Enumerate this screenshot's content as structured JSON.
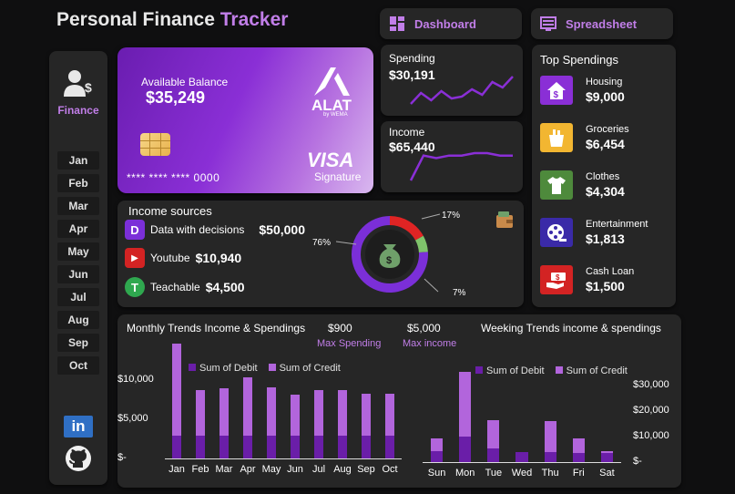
{
  "header": {
    "title_part1": "Personal Finance ",
    "title_part2": "Tracker",
    "dashboard_label": "Dashboard",
    "spreadsheet_label": "Spreadsheet"
  },
  "sidebar": {
    "finance_label": "Finance",
    "months": [
      "Jan",
      "Feb",
      "Mar",
      "Apr",
      "May",
      "Jun",
      "Jul",
      "Aug",
      "Sep",
      "Oct"
    ]
  },
  "card": {
    "balance_label": "Available Balance",
    "balance_value": "$35,249",
    "brand": "ALAT",
    "brand_sub": "by WEMA",
    "number": "**** **** **** 0000",
    "network": "VISA",
    "network_sub": "Signature"
  },
  "spending": {
    "label": "Spending",
    "value": "$30,191",
    "trend": [
      34,
      40,
      36,
      41,
      37,
      38,
      42,
      39,
      46,
      43,
      49
    ]
  },
  "income": {
    "label": "Income",
    "value": "$65,440",
    "trend": [
      48,
      38,
      39,
      38,
      38,
      37,
      37,
      38,
      38
    ]
  },
  "income_sources": {
    "title": "Income sources",
    "items": [
      {
        "name": "Data with decisions",
        "value": "$50,000",
        "icon": "D",
        "color": "#7b2fd8"
      },
      {
        "name": "Youtube",
        "value": "$10,940",
        "icon": "▶",
        "color": "#d32323"
      },
      {
        "name": "Teachable",
        "value": "$4,500",
        "icon": "T",
        "color": "#2fa84f"
      }
    ],
    "donut": {
      "slices": [
        {
          "label": "76%",
          "value": 76,
          "color": "#7b2fd8"
        },
        {
          "label": "17%",
          "value": 17,
          "color": "#e02424"
        },
        {
          "label": "7%",
          "value": 7,
          "color": "#7fc36b"
        }
      ]
    }
  },
  "top_spendings": {
    "title": "Top Spendings",
    "items": [
      {
        "name": "Housing",
        "value": "$9,000",
        "icon": "house-dollar-icon",
        "color": "#8a2fd6"
      },
      {
        "name": "Groceries",
        "value": "$6,454",
        "icon": "grocery-bag-icon",
        "color": "#f2b631"
      },
      {
        "name": "Clothes",
        "value": "$4,304",
        "icon": "shirt-icon",
        "color": "#4e8a3c"
      },
      {
        "name": "Entertainment",
        "value": "$1,813",
        "icon": "film-reel-icon",
        "color": "#3a2aa8"
      },
      {
        "name": "Cash Loan",
        "value": "$1,500",
        "icon": "cash-hand-icon",
        "color": "#d32323"
      }
    ]
  },
  "trends": {
    "monthly_title": "Monthly Trends Income & Spendings",
    "max_spending_value": "$900",
    "max_spending_label": "Max Spending",
    "max_income_value": "$5,000",
    "max_income_label": "Max income",
    "weekly_title": "Weeking Trends income & spendings"
  },
  "colors": {
    "debit": "#6a1ea8",
    "credit": "#b265dc",
    "panel": "#262626",
    "accent": "#c17ee8"
  },
  "chart_data": [
    {
      "type": "bar",
      "stacked": true,
      "categories": [
        "Jan",
        "Feb",
        "Mar",
        "Apr",
        "May",
        "Jun",
        "Jul",
        "Aug",
        "Sep",
        "Oct"
      ],
      "series": [
        {
          "name": "Sum of Debit",
          "values": [
            2900,
            2900,
            2900,
            2900,
            2900,
            2900,
            2900,
            2900,
            2900,
            2900
          ]
        },
        {
          "name": "Sum of Credit",
          "values": [
            11700,
            5800,
            6100,
            7400,
            6200,
            5200,
            5800,
            5800,
            5400,
            5300
          ]
        }
      ],
      "yticks": [
        "$-",
        "$5,000",
        "$10,000"
      ],
      "ylim": [
        0,
        15000
      ],
      "legend": "top"
    },
    {
      "type": "bar",
      "stacked": true,
      "categories": [
        "Sun",
        "Mon",
        "Tue",
        "Wed",
        "Thu",
        "Fri",
        "Sat"
      ],
      "series": [
        {
          "name": "Sum of Debit",
          "values": [
            4200,
            10000,
            5500,
            3800,
            4000,
            3500,
            3400
          ]
        },
        {
          "name": "Sum of Credit",
          "values": [
            5000,
            25200,
            11000,
            0,
            12000,
            5800,
            1000
          ]
        }
      ],
      "yticks": [
        "$-",
        "$10,000",
        "$20,000",
        "$30,000"
      ],
      "ylim": [
        0,
        30000
      ],
      "legend": "top"
    }
  ]
}
